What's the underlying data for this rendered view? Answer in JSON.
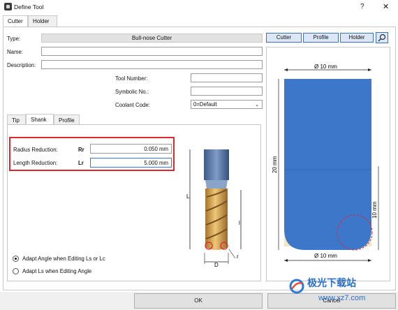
{
  "window": {
    "title": "Define Tool",
    "help": "?",
    "close": "✕"
  },
  "top_tabs": [
    "Cutter",
    "Holder"
  ],
  "fields": {
    "type_label": "Type:",
    "type_value": "Bull-nose Cutter",
    "name_label": "Name:",
    "name_value": "",
    "description_label": "Description:",
    "description_value": "",
    "tool_number_label": "Tool Number:",
    "tool_number_value": "",
    "symbolic_label": "Symbolic No.:",
    "symbolic_value": "",
    "coolant_label": "Coolant Code:",
    "coolant_value": "0=Default"
  },
  "view_buttons": [
    "Cutter",
    "Profile",
    "Holder"
  ],
  "inner_tabs": [
    "Tip",
    "Shank",
    "Profile"
  ],
  "shank": {
    "radius_label": "Radius Reduction:",
    "radius_symbol": "Rr",
    "radius_value": "0.050 mm",
    "length_label": "Length Reduction:",
    "length_symbol": "Lr",
    "length_value": "5.000 mm"
  },
  "diagram_labels": {
    "L": "L",
    "l": "l",
    "D": "D",
    "r": "r"
  },
  "options": {
    "adapt_angle": "Adapt Angle when Editing Ls or Lc",
    "adapt_ls": "Adapt Ls when Editing Angle",
    "selected": "adapt_angle"
  },
  "preview": {
    "top_dim": "Ø 10 mm",
    "bottom_dim": "Ø 10 mm",
    "left_dim": "20 mm",
    "right_dim": "10 mm",
    "body_color": "#3d77c9",
    "tip_color": "#f4e7c2"
  },
  "buttons": {
    "ok": "OK",
    "cancel": "Cancel"
  },
  "watermark": {
    "text": "极光下载站",
    "url": "www.xz7.com"
  }
}
